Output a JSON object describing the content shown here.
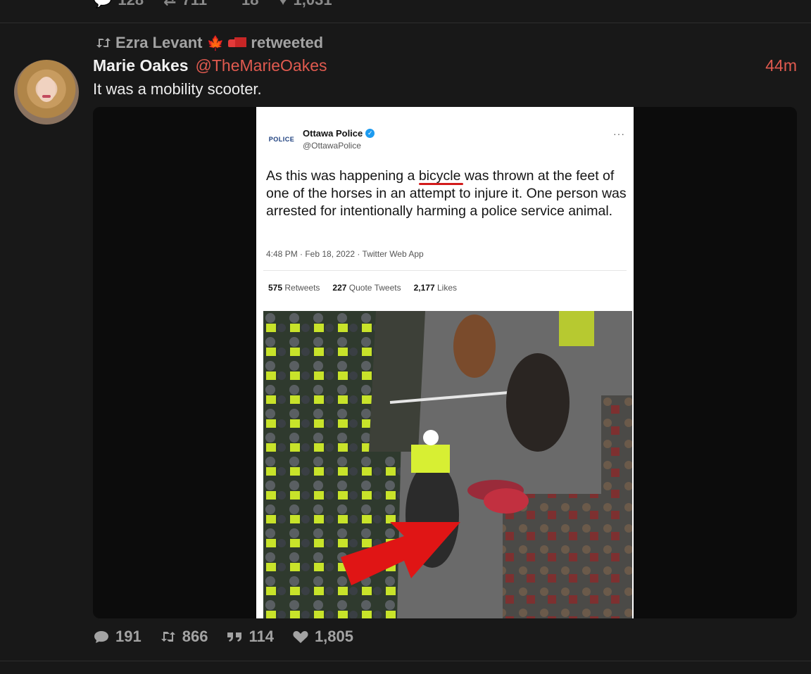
{
  "previous_tweet": {
    "stats": {
      "replies": "128",
      "retweets": "711",
      "quotes": "18",
      "likes": "1,031"
    }
  },
  "tweet": {
    "retweeted_by": "Ezra Levant",
    "retweeted_label": "retweeted",
    "author": {
      "name": "Marie Oakes",
      "handle": "@TheMarieOakes"
    },
    "time": "44m",
    "text": "It was a mobility scooter.",
    "embedded": {
      "name": "Ottawa Police",
      "handle": "@OttawaPolice",
      "logo_text": "POLICE",
      "more": "···",
      "text_before": "As this was happening a ",
      "text_highlight": "bicycle",
      "text_after": " was thrown at the feet of one of the horses in an attempt to injure it. One person was arrested for intentionally harming a police service animal.",
      "meta": "4:48 PM · Feb 18, 2022 · Twitter Web App",
      "stats": {
        "retweets_count": "575",
        "retweets_label": "Retweets",
        "quotes_count": "227",
        "quotes_label": "Quote Tweets",
        "likes_count": "2,177",
        "likes_label": "Likes"
      }
    },
    "stats": {
      "replies": "191",
      "retweets": "866",
      "quotes": "114",
      "likes": "1,805"
    }
  },
  "colors": {
    "accent": "#e05a4f",
    "background": "#181818",
    "muted": "#a3a3a3"
  }
}
